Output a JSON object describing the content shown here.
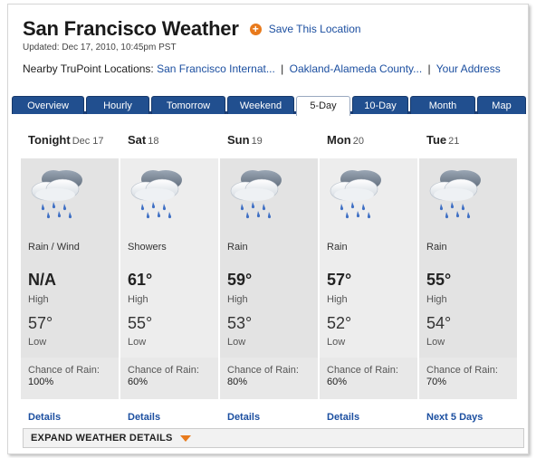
{
  "header": {
    "title": "San Francisco Weather",
    "save_label": "Save This Location",
    "updated": "Updated: Dec 17, 2010, 10:45pm PST"
  },
  "nearby": {
    "label": "Nearby TruPoint Locations:",
    "links": [
      "San Francisco Internat...",
      "Oakland-Alameda County...",
      "Your Address"
    ],
    "separator": "|"
  },
  "tabs": [
    {
      "label": "Overview"
    },
    {
      "label": "Hourly"
    },
    {
      "label": "Tomorrow"
    },
    {
      "label": "Weekend"
    },
    {
      "label": "5-Day"
    },
    {
      "label": "10-Day"
    },
    {
      "label": "Month"
    },
    {
      "label": "Map"
    }
  ],
  "active_tab": "5-Day",
  "days": [
    {
      "day": "Tonight",
      "date": "Dec 17",
      "condition": "Rain / Wind",
      "high": "N/A",
      "high_label": "High",
      "low": "57°",
      "low_label": "Low",
      "rain_label": "Chance of Rain:",
      "rain": "100%",
      "link": "Details",
      "bg": "#e3e3e3"
    },
    {
      "day": "Sat",
      "date": "18",
      "condition": "Showers",
      "high": "61°",
      "high_label": "High",
      "low": "55°",
      "low_label": "Low",
      "rain_label": "Chance of Rain:",
      "rain": "60%",
      "link": "Details",
      "bg": "#ededed"
    },
    {
      "day": "Sun",
      "date": "19",
      "condition": "Rain",
      "high": "59°",
      "high_label": "High",
      "low": "53°",
      "low_label": "Low",
      "rain_label": "Chance of Rain:",
      "rain": "80%",
      "link": "Details",
      "bg": "#e3e3e3"
    },
    {
      "day": "Mon",
      "date": "20",
      "condition": "Rain",
      "high": "57°",
      "high_label": "High",
      "low": "52°",
      "low_label": "Low",
      "rain_label": "Chance of Rain:",
      "rain": "60%",
      "link": "Details",
      "bg": "#ededed"
    },
    {
      "day": "Tue",
      "date": "21",
      "condition": "Rain",
      "high": "55°",
      "high_label": "High",
      "low": "54°",
      "low_label": "Low",
      "rain_label": "Chance of Rain:",
      "rain": "70%",
      "link": "Next 5 Days",
      "bg": "#e3e3e3"
    }
  ],
  "expand_label": "EXPAND WEATHER DETAILS",
  "colors": {
    "link": "#1c4fa0",
    "tab": "#214f8f",
    "accent": "#e87a1c"
  },
  "icons": {
    "save": "plus-circle-icon",
    "weather": "rain-cloud-icon",
    "expand": "caret-down-icon"
  }
}
